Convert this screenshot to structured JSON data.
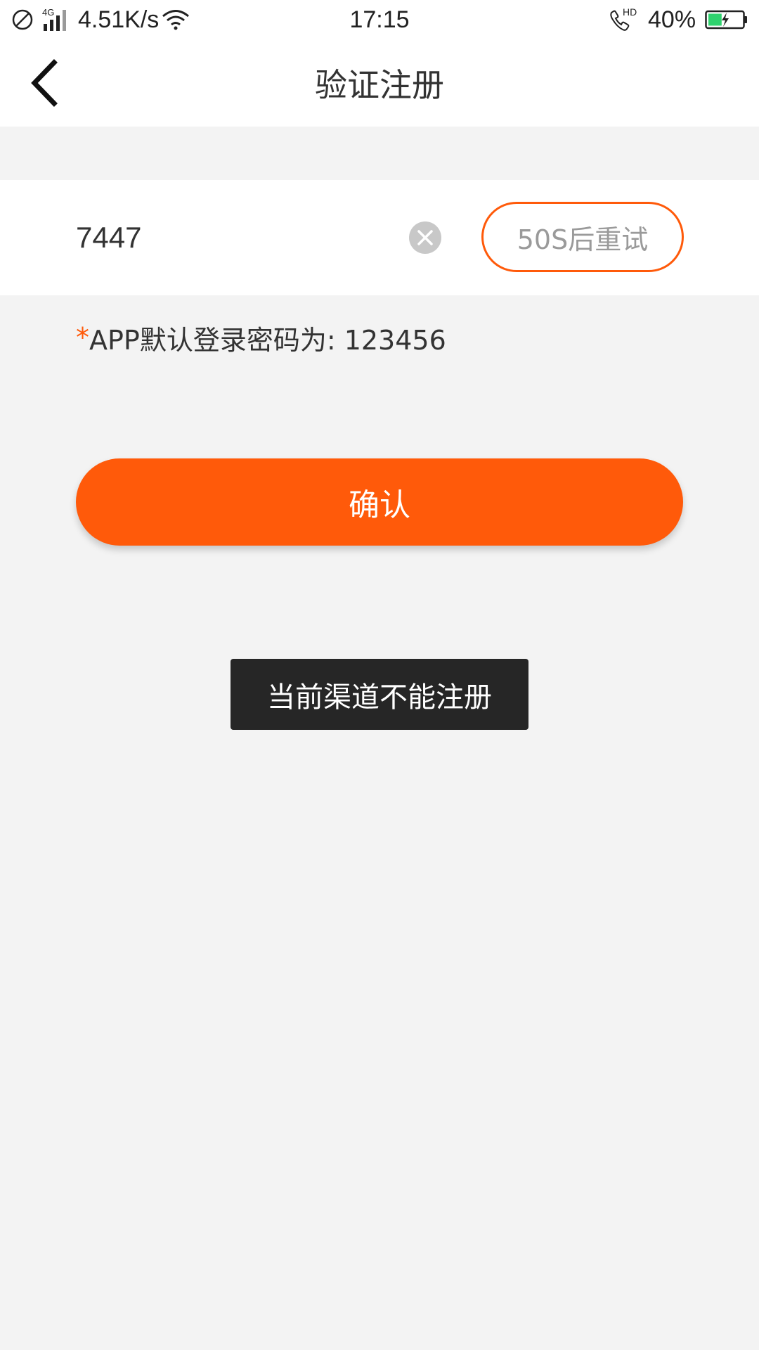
{
  "status_bar": {
    "network_type": "4G",
    "net_speed": "4.51K/s",
    "time": "17:15",
    "call_badge": "HD",
    "battery_percent": "40%",
    "battery_level": 0.4,
    "icons": [
      "do-not-disturb-icon",
      "signal-icon",
      "wifi-icon",
      "hd-call-icon",
      "battery-charging-icon"
    ]
  },
  "header": {
    "title": "验证注册",
    "back_icon": "chevron-left-icon"
  },
  "verification": {
    "code_value": "7447",
    "clear_icon": "clear-icon",
    "retry_label": "50S后重试"
  },
  "hint": {
    "asterisk": "*",
    "text": "APP默认登录密码为: 123456"
  },
  "actions": {
    "confirm_label": "确认"
  },
  "toast": {
    "message": "当前渠道不能注册"
  },
  "colors": {
    "accent": "#ff5a0a",
    "background": "#f3f3f3",
    "toast_bg": "#262626",
    "battery_fill": "#2fd26e"
  }
}
